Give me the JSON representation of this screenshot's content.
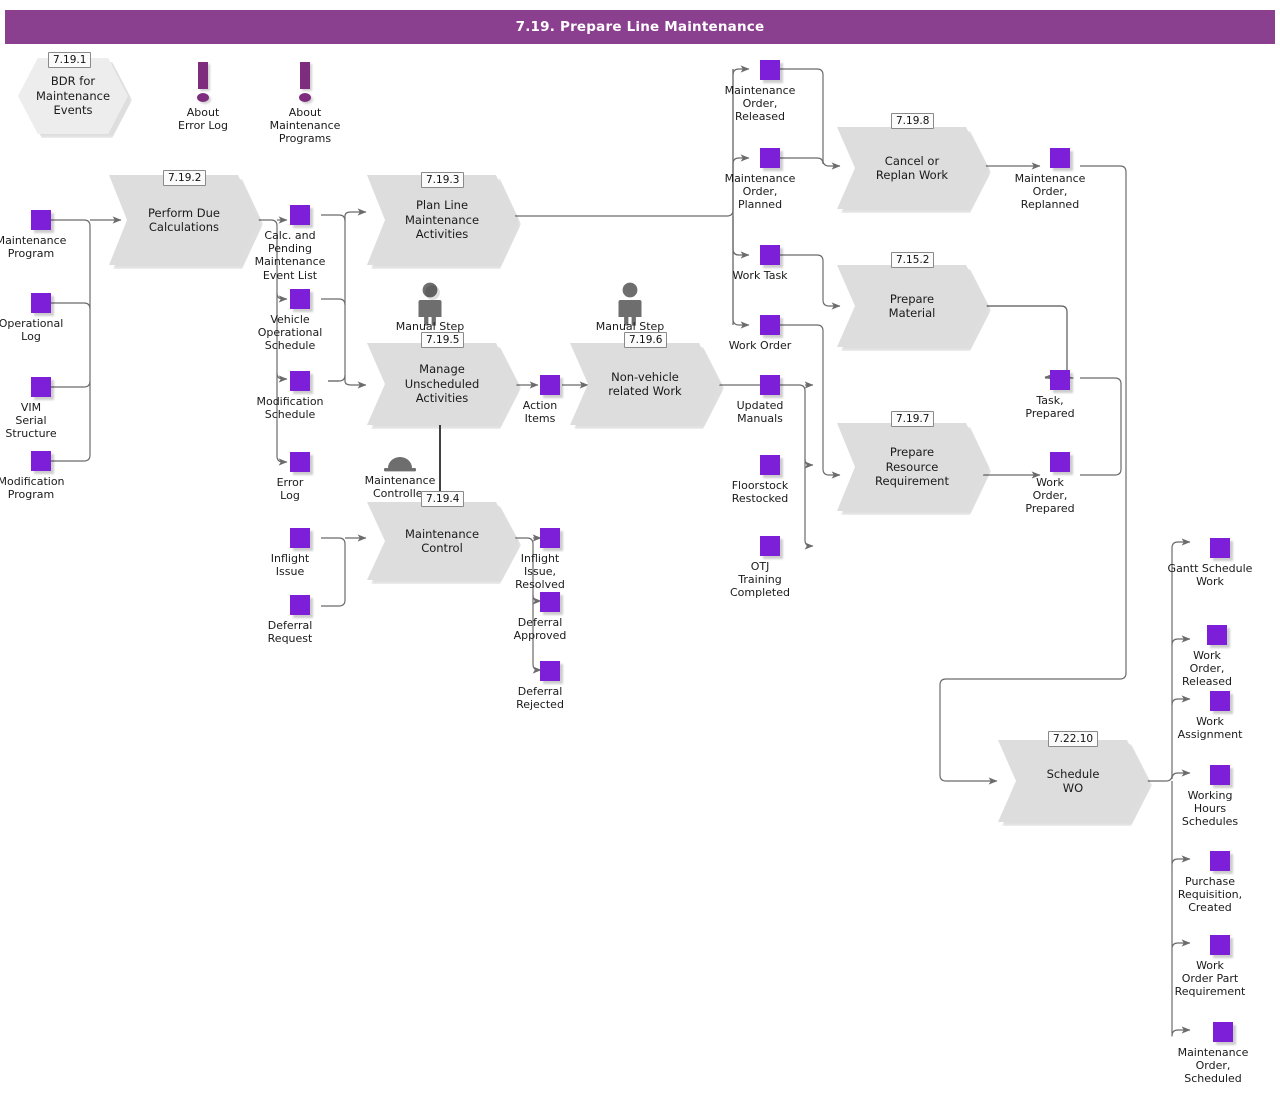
{
  "header": {
    "title": "7.19. Prepare Line Maintenance"
  },
  "colors": {
    "title_bar": "#8b3f8f",
    "data_object": "#7d1ed8",
    "process_fill": "#dddddd",
    "hexagon_fill": "#ededed",
    "note_purple": "#7e2d7e",
    "role_gray": "#6e6e6e",
    "link": "#6b6b6b"
  },
  "hexagons": [
    {
      "tag": "7.19.1",
      "label": "BDR for\nMaintenance\nEvents",
      "name": "bdr-for-maintenance-events"
    }
  ],
  "notes": [
    {
      "label": "About\nError Log",
      "name": "about-error-log"
    },
    {
      "label": "About\nMaintenance\nPrograms",
      "name": "about-maintenance-programs"
    }
  ],
  "roles": [
    {
      "label": "Manual Step",
      "name": "manual-step-1",
      "icon": "person-icon"
    },
    {
      "label": "Manual Step",
      "name": "manual-step-2",
      "icon": "person-icon"
    },
    {
      "label": "Maintenance\nController",
      "name": "maintenance-controller",
      "icon": "controller-icon"
    }
  ],
  "processes": [
    {
      "tag": "7.19.2",
      "label": "Perform Due\nCalculations",
      "name": "perform-due-calculations"
    },
    {
      "tag": "7.19.3",
      "label": "Plan Line\nMaintenance\nActivities",
      "name": "plan-line-maintenance-activities"
    },
    {
      "tag": "7.19.5",
      "label": "Manage\nUnscheduled\nActivities",
      "name": "manage-unscheduled-activities"
    },
    {
      "tag": "7.19.6",
      "label": "Non-vehicle\nrelated Work",
      "name": "non-vehicle-related-work"
    },
    {
      "tag": "7.19.4",
      "label": "Maintenance\nControl",
      "name": "maintenance-control"
    },
    {
      "tag": "7.19.8",
      "label": "Cancel or\nReplan Work",
      "name": "cancel-or-replan-work"
    },
    {
      "tag": "7.15.2",
      "label": "Prepare\nMaterial",
      "name": "prepare-material"
    },
    {
      "tag": "7.19.7",
      "label": "Prepare\nResource\nRequirement",
      "name": "prepare-resource-requirement"
    },
    {
      "tag": "7.22.10",
      "label": "Schedule\nWO",
      "name": "schedule-wo"
    }
  ],
  "data_objects": [
    {
      "label": "Maintenance\nProgram",
      "name": "maintenance-program"
    },
    {
      "label": "Operational\nLog",
      "name": "operational-log"
    },
    {
      "label": "VIM\nSerial\nStructure",
      "name": "vim-serial-structure"
    },
    {
      "label": "Modification\nProgram",
      "name": "modification-program"
    },
    {
      "label": "Calc. and\nPending\nMaintenance\nEvent List",
      "name": "calc-and-pending-maintenance-event-list"
    },
    {
      "label": "Vehicle\nOperational\nSchedule",
      "name": "vehicle-operational-schedule"
    },
    {
      "label": "Modification\nSchedule",
      "name": "modification-schedule"
    },
    {
      "label": "Error\nLog",
      "name": "error-log"
    },
    {
      "label": "Inflight\nIssue",
      "name": "inflight-issue"
    },
    {
      "label": "Deferral\nRequest",
      "name": "deferral-request"
    },
    {
      "label": "Inflight\nIssue,\nResolved",
      "name": "inflight-issue-resolved"
    },
    {
      "label": "Deferral\nApproved",
      "name": "deferral-approved"
    },
    {
      "label": "Deferral\nRejected",
      "name": "deferral-rejected"
    },
    {
      "label": "Action\nItems",
      "name": "action-items"
    },
    {
      "label": "Maintenance\nOrder,\nReleased",
      "name": "maintenance-order-released"
    },
    {
      "label": "Maintenance\nOrder,\nPlanned",
      "name": "maintenance-order-planned"
    },
    {
      "label": "Work Task",
      "name": "work-task"
    },
    {
      "label": "Work Order",
      "name": "work-order"
    },
    {
      "label": "Updated\nManuals",
      "name": "updated-manuals"
    },
    {
      "label": "Floorstock\nRestocked",
      "name": "floorstock-restocked"
    },
    {
      "label": "OTJ\nTraining\nCompleted",
      "name": "otj-training-completed"
    },
    {
      "label": "Maintenance\nOrder,\nReplanned",
      "name": "maintenance-order-replanned"
    },
    {
      "label": "Task,\nPrepared",
      "name": "task-prepared"
    },
    {
      "label": "Work\nOrder,\nPrepared",
      "name": "work-order-prepared"
    },
    {
      "label": "Gantt Schedule\nWork",
      "name": "gantt-schedule-work"
    },
    {
      "label": "Work\nOrder,\nReleased",
      "name": "work-order-released"
    },
    {
      "label": "Work\nAssignment",
      "name": "work-assignment"
    },
    {
      "label": "Working\nHours\nSchedules",
      "name": "working-hours-schedules"
    },
    {
      "label": "Purchase\nRequisition,\nCreated",
      "name": "purchase-requisition-created"
    },
    {
      "label": "Work\nOrder Part\nRequirement",
      "name": "work-order-part-requirement"
    },
    {
      "label": "Maintenance\nOrder,\nScheduled",
      "name": "maintenance-order-scheduled"
    }
  ]
}
